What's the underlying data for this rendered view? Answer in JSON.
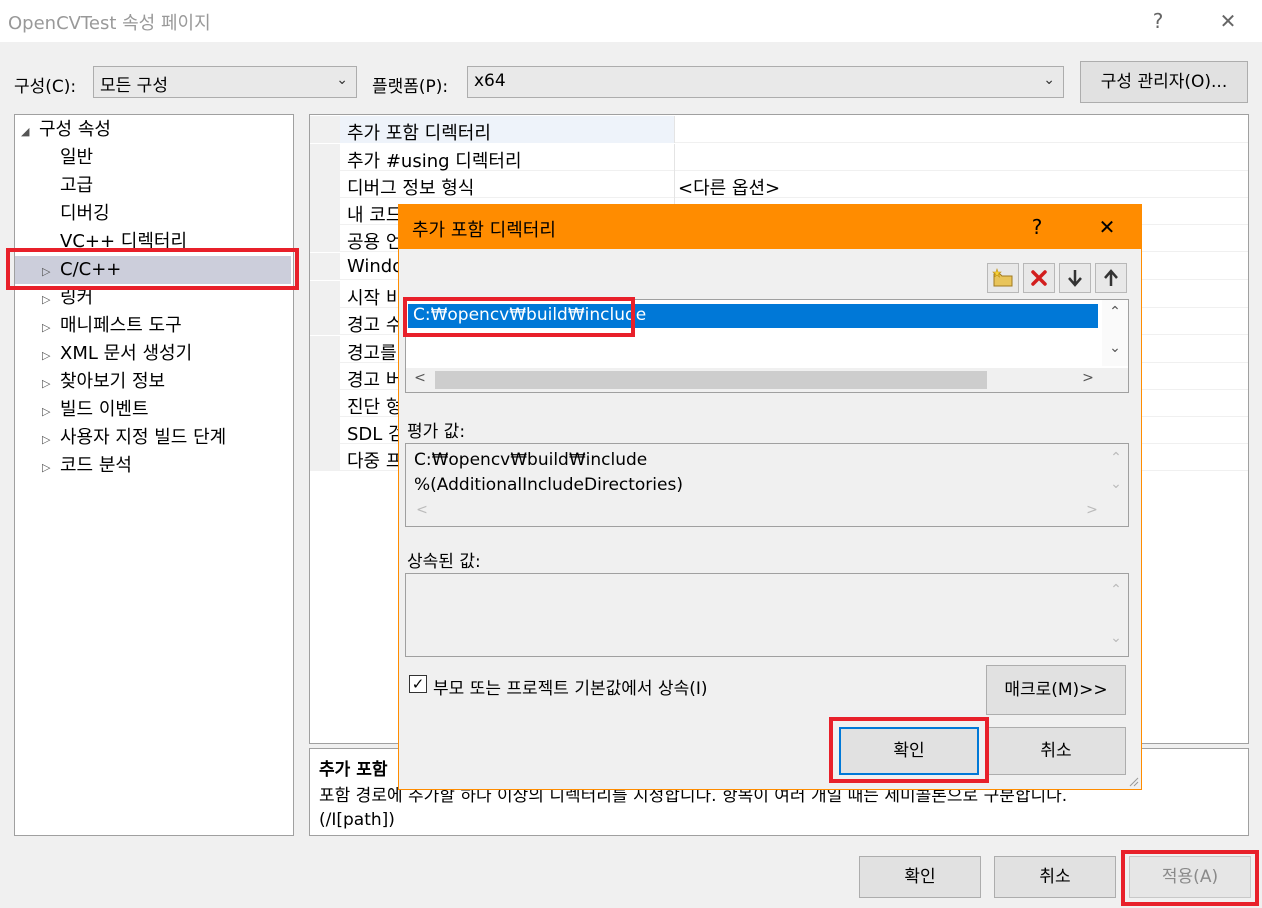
{
  "window": {
    "title": "OpenCVTest 속성 페이지",
    "help_glyph": "?",
    "close_glyph": "✕"
  },
  "toolbar": {
    "config_label": "구성(C):",
    "config_value": "모든 구성",
    "platform_label": "플랫폼(P):",
    "platform_value": "x64",
    "config_manager_button": "구성 관리자(O)..."
  },
  "tree": {
    "root": "구성 속성",
    "children": [
      "일반",
      "고급",
      "디버깅",
      "VC++ 디렉터리"
    ],
    "expandable": [
      "C/C++",
      "링커",
      "매니페스트 도구",
      "XML 문서 생성기",
      "찾아보기 정보",
      "빌드 이벤트",
      "사용자 지정 빌드 단계",
      "코드 분석"
    ]
  },
  "grid": {
    "rows": [
      {
        "name": "추가 포함 디렉터리",
        "value": ""
      },
      {
        "name": "추가 #using 디렉터리",
        "value": ""
      },
      {
        "name": "디버그 정보 형식",
        "value": "<다른 옵션>"
      },
      {
        "name": "내 코드",
        "value": ""
      },
      {
        "name": "공용 언",
        "value": ""
      },
      {
        "name": "Windo",
        "value": ""
      },
      {
        "name": "시작 비",
        "value": ""
      },
      {
        "name": "경고 수",
        "value": ""
      },
      {
        "name": "경고를",
        "value": ""
      },
      {
        "name": "경고 버",
        "value": ""
      },
      {
        "name": "진단 형",
        "value": ""
      },
      {
        "name": "SDL 검",
        "value": ""
      },
      {
        "name": "다중 프",
        "value": ""
      }
    ]
  },
  "description": {
    "title": "추가 포함",
    "text": "포함 경로에 추가할 하나 이상의 디렉터리를 지정합니다. 항목이 여러 개일 때는 세미콜론으로 구분합니다.",
    "flag": "(/I[path])"
  },
  "dialog": {
    "title": "추가 포함 디렉터리",
    "help_glyph": "?",
    "close_glyph": "✕",
    "toolbar_icons": [
      "new-folder-icon",
      "delete-icon",
      "move-down-icon",
      "move-up-icon"
    ],
    "list_items": [
      "C:₩opencv₩build₩include"
    ],
    "evaluated_label": "평가 값:",
    "evaluated_lines": [
      "C:₩opencv₩build₩include",
      "%(AdditionalIncludeDirectories)"
    ],
    "inherited_label": "상속된 값:",
    "inherit_checkbox_label": "부모 또는 프로젝트 기본값에서 상속(I)",
    "inherit_checked": true,
    "macros_button": "매크로(M)>>",
    "ok_button": "확인",
    "cancel_button": "취소"
  },
  "footer": {
    "ok_button": "확인",
    "cancel_button": "취소",
    "apply_button": "적용(A)"
  },
  "colors": {
    "dialog_title_bg": "#ff8c00",
    "selection_bg": "#0078d7",
    "highlight_red": "#e8202a",
    "tree_selected_bg": "#cccedb"
  }
}
